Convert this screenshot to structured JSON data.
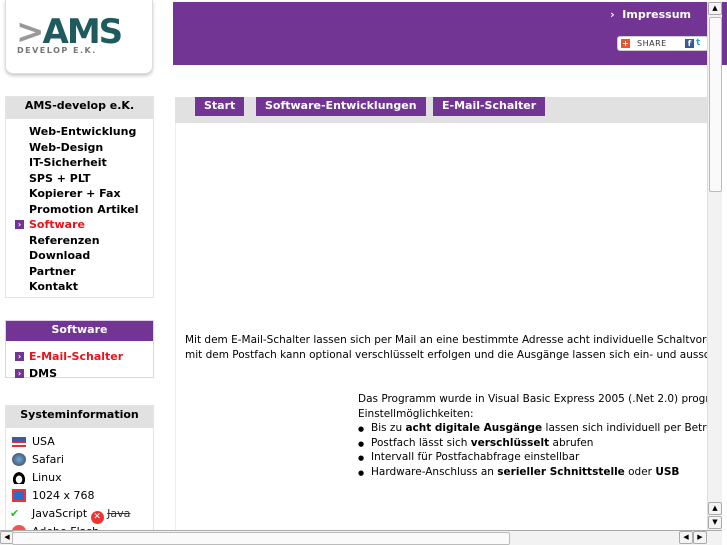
{
  "logo": {
    "text": ">AMS",
    "subtext": "DEVELOP E.K."
  },
  "header": {
    "impressum": "Impressum",
    "share": "SHARE",
    "brand_color": "#733594"
  },
  "main_nav": {
    "title": "AMS-develop e.K.",
    "items": [
      {
        "label": "Web-Entwicklung",
        "active": false
      },
      {
        "label": "Web-Design",
        "active": false
      },
      {
        "label": "IT-Sicherheit",
        "active": false
      },
      {
        "label": "SPS + PLT",
        "active": false
      },
      {
        "label": "Kopierer + Fax",
        "active": false
      },
      {
        "label": "Promotion Artikel",
        "active": false
      },
      {
        "label": "Software",
        "active": true
      },
      {
        "label": "Referenzen",
        "active": false
      },
      {
        "label": "Download",
        "active": false
      },
      {
        "label": "Partner",
        "active": false
      },
      {
        "label": "Kontakt",
        "active": false
      }
    ]
  },
  "software_nav": {
    "title": "Software",
    "items": [
      {
        "label": "E-Mail-Schalter",
        "active": true
      },
      {
        "label": "DMS",
        "active": false
      }
    ]
  },
  "sysinfo": {
    "title": "Systeminformation",
    "country": "USA",
    "browser": "Safari",
    "os": "Linux",
    "resolution": "1024 x 768",
    "javascript": "JavaScript",
    "java": "Java",
    "flash": "Adobe Flash"
  },
  "breadcrumb": [
    "Start",
    "Software-Entwicklungen",
    "E-Mail-Schalter"
  ],
  "content": {
    "intro_line1": "Mit dem E-Mail-Schalter lassen sich per Mail an eine bestimmte Adresse acht individuelle Schaltvorgä",
    "intro_line2": "mit dem Postfach kann optional verschlüsselt erfolgen und die Ausgänge lassen sich ein- und aussc",
    "program_line": "Das Programm wurde in Visual Basic Express 2005 (.Net 2.0) progr",
    "settings_label": "Einstellmöglichkeiten:",
    "bullets": [
      {
        "pre": "Bis zu ",
        "bold": "acht digitale Ausgänge",
        "post": " lassen sich individuell per Betre"
      },
      {
        "pre": "Postfach lässt sich ",
        "bold": "verschlüsselt",
        "post": " abrufen"
      },
      {
        "pre": "Intervall für Postfachabfrage einstellbar",
        "bold": "",
        "post": ""
      },
      {
        "pre": "Hardware-Anschluss an ",
        "bold": "serieller Schnittstelle",
        "post": " oder ",
        "bold2": "USB"
      }
    ]
  }
}
